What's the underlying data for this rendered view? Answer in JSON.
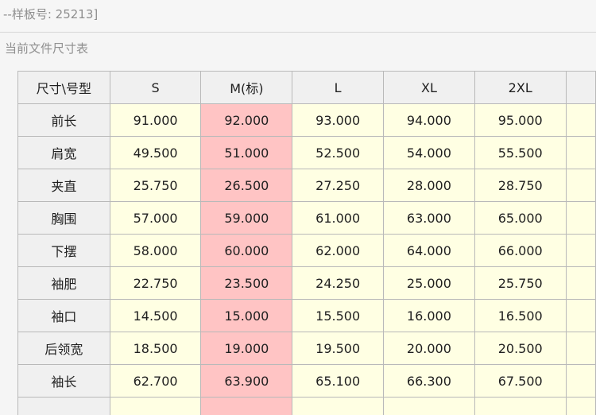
{
  "window": {
    "title": "--样板号: 25213]"
  },
  "dialog": {
    "title": "当前文件尺寸表"
  },
  "table": {
    "corner_label": "尺寸\\号型",
    "columns": [
      "S",
      "M(标)",
      "L",
      "XL",
      "2XL"
    ],
    "base_column_index": 1,
    "rows": [
      {
        "label": "前长",
        "values": [
          "91.000",
          "92.000",
          "93.000",
          "94.000",
          "95.000"
        ]
      },
      {
        "label": "肩宽",
        "values": [
          "49.500",
          "51.000",
          "52.500",
          "54.000",
          "55.500"
        ]
      },
      {
        "label": "夹直",
        "values": [
          "25.750",
          "26.500",
          "27.250",
          "28.000",
          "28.750"
        ]
      },
      {
        "label": "胸围",
        "values": [
          "57.000",
          "59.000",
          "61.000",
          "63.000",
          "65.000"
        ]
      },
      {
        "label": "下摆",
        "values": [
          "58.000",
          "60.000",
          "62.000",
          "64.000",
          "66.000"
        ]
      },
      {
        "label": "袖肥",
        "values": [
          "22.750",
          "23.500",
          "24.250",
          "25.000",
          "25.750"
        ]
      },
      {
        "label": "袖口",
        "values": [
          "14.500",
          "15.000",
          "15.500",
          "16.000",
          "16.500"
        ]
      },
      {
        "label": "后领宽",
        "values": [
          "18.500",
          "19.000",
          "19.500",
          "20.000",
          "20.500"
        ]
      },
      {
        "label": "袖长",
        "values": [
          "62.700",
          "63.900",
          "65.100",
          "66.300",
          "67.500"
        ]
      }
    ]
  },
  "colors": {
    "header_bg": "#f0f0f0",
    "cell_bg": "#ffffe3",
    "base_column_bg": "#ffc4c4",
    "grid_line": "#b9b9b9"
  }
}
